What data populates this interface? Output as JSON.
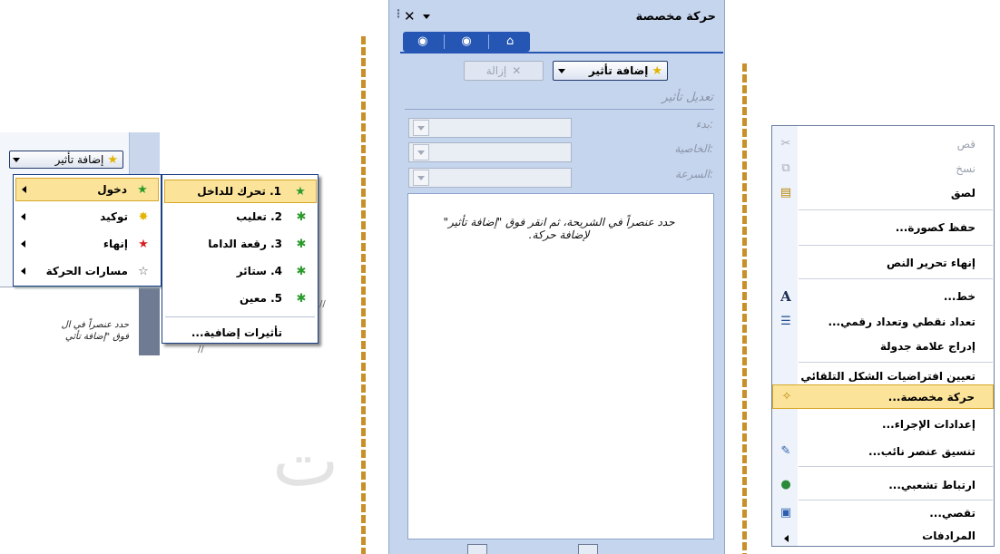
{
  "panel1": {
    "add_effect_label": "إضافة تأثير",
    "menu": [
      {
        "label": "دخول",
        "icon": "star-green-icon"
      },
      {
        "label": "توكيد",
        "icon": "star-yellow-icon"
      },
      {
        "label": "إنهاء",
        "icon": "star-red-icon"
      },
      {
        "label": "مسارات الحركة",
        "icon": "star-outline-icon"
      }
    ],
    "submenu": [
      {
        "label": "1. تحرك للداخل"
      },
      {
        "label": "2. تعليب"
      },
      {
        "label": "3. رقعة الداما"
      },
      {
        "label": "4. ستائر"
      },
      {
        "label": "5. معين"
      }
    ],
    "more_effects": "تأثيرات إضافية...",
    "hint_line1": "حدد عنصراً في ال",
    "hint_line2": "فوق \"إضافة تأثي"
  },
  "panel2": {
    "title": "حركة مخصصة",
    "nav": [
      "back-icon",
      "forward-icon",
      "home-icon"
    ],
    "add_effect_label": "إضافة تأثير",
    "remove_label": "إزالة",
    "edit_effect": "تعديل تأثير",
    "start_label": "بدء:",
    "property_label": "الخاصية:",
    "speed_label": "السرعة:",
    "message": "حدد عنصراً في الشريحة، ثم انقر فوق \"إضافة تأثير\" لإضافة حركة."
  },
  "watermark": "ت",
  "context_menu": {
    "items": [
      {
        "label": "قص",
        "icon": "scissors-icon",
        "disabled": true
      },
      {
        "label": "نسخ",
        "icon": "copy-icon",
        "disabled": true
      },
      {
        "label": "لصق",
        "icon": "paste-icon",
        "disabled": false
      },
      {
        "label": "حفظ كصورة...",
        "icon": "",
        "disabled": false
      },
      {
        "label": "إنهاء تحرير النص",
        "icon": "",
        "disabled": false
      },
      {
        "label": "خط...",
        "icon": "font-icon",
        "disabled": false
      },
      {
        "label": "تعداد نقطي وتعداد رقمي...",
        "icon": "bullets-icon",
        "disabled": false
      },
      {
        "label": "إدراج علامة جدولة",
        "icon": "",
        "disabled": false
      },
      {
        "label": "تعيين افتراضيات الشكل التلقائي",
        "icon": "",
        "disabled": false
      },
      {
        "label": "حركة مخصصة...",
        "icon": "custom-animation-icon",
        "disabled": false
      },
      {
        "label": "إعدادات الإجراء...",
        "icon": "",
        "disabled": false
      },
      {
        "label": "تنسيق عنصر نائب...",
        "icon": "format-icon",
        "disabled": false
      },
      {
        "label": "ارتباط تشعبي...",
        "icon": "hyperlink-icon",
        "disabled": false
      },
      {
        "label": "تقصي...",
        "icon": "research-icon",
        "disabled": false
      },
      {
        "label": "المرادفات",
        "icon": "",
        "disabled": false
      }
    ]
  }
}
